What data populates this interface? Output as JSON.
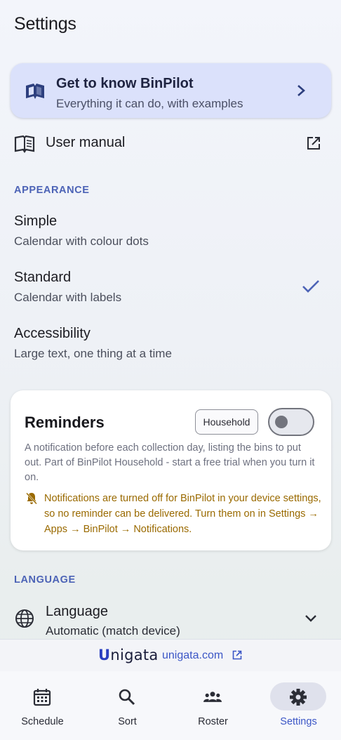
{
  "page": {
    "title": "Settings"
  },
  "promo": {
    "title": "Get to know BinPilot",
    "subtitle": "Everything it can do, with examples",
    "icon": "book-icon"
  },
  "manual": {
    "label": "User manual",
    "icon": "manual-icon",
    "action_icon": "open-external-icon"
  },
  "appearance": {
    "heading": "APPEARANCE",
    "options": [
      {
        "title": "Simple",
        "subtitle": "Calendar with colour dots",
        "selected": false
      },
      {
        "title": "Standard",
        "subtitle": "Calendar with labels",
        "selected": true
      },
      {
        "title": "Accessibility",
        "subtitle": "Large text, one thing at a time",
        "selected": false
      }
    ]
  },
  "reminders": {
    "title": "Reminders",
    "badge": "Household",
    "enabled": false,
    "description": "A notification before each collection day, listing the bins to put out. Part of BinPilot Household - start a free trial when you turn it on.",
    "warning": "Notifications are turned off for BinPilot in your device settings, so no reminder can be delivered. Turn them on in Settings → Apps → BinPilot → Notifications."
  },
  "language": {
    "heading": "LANGUAGE",
    "label": "Language",
    "value": "Automatic (match device)"
  },
  "footer": {
    "brand": "Unigata",
    "link": "unigata.com"
  },
  "nav": {
    "items": [
      {
        "label": "Schedule",
        "icon": "calendar-icon",
        "active": false
      },
      {
        "label": "Sort",
        "icon": "search-icon",
        "active": false
      },
      {
        "label": "Roster",
        "icon": "group-icon",
        "active": false
      },
      {
        "label": "Settings",
        "icon": "gear-icon",
        "active": true
      }
    ]
  },
  "colors": {
    "accent": "#3b56c6",
    "promo_bg": "#dbe1fb",
    "warning": "#9a6a00",
    "section_heading": "#4c63b6"
  }
}
